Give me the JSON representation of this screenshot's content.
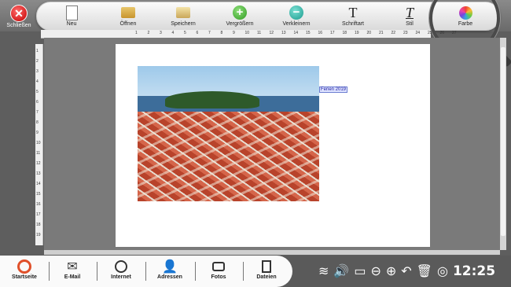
{
  "toolbar": {
    "close_label": "Schließen",
    "tools": [
      {
        "label": "Neu",
        "icon": "new-document-icon"
      },
      {
        "label": "Öffnen",
        "icon": "open-folder-icon"
      },
      {
        "label": "Speichern",
        "icon": "save-icon"
      },
      {
        "label": "Vergrößern",
        "icon": "zoom-in-icon"
      },
      {
        "label": "Verkleinern",
        "icon": "zoom-out-icon"
      },
      {
        "label": "Schriftart",
        "icon": "font-icon"
      },
      {
        "label": "Stil",
        "icon": "style-icon"
      },
      {
        "label": "Farbe",
        "icon": "color-wheel-icon"
      }
    ]
  },
  "ruler": {
    "h_ticks": [
      "1",
      "2",
      "3",
      "4",
      "5",
      "6",
      "7",
      "8",
      "9",
      "10",
      "11",
      "12",
      "13",
      "14",
      "15",
      "16",
      "17",
      "18",
      "19",
      "20",
      "21",
      "22",
      "23",
      "24",
      "25",
      "26",
      "27"
    ],
    "v_ticks": [
      "1",
      "2",
      "3",
      "4",
      "5",
      "6",
      "7",
      "8",
      "9",
      "10",
      "11",
      "12",
      "13",
      "14",
      "15",
      "16",
      "17",
      "18",
      "19"
    ]
  },
  "document": {
    "caption": "Ferien 2019"
  },
  "taskbar": {
    "items": [
      {
        "label": "Startseite",
        "icon": "home-logo-icon"
      },
      {
        "label": "E-Mail",
        "icon": "mail-icon"
      },
      {
        "label": "Internet",
        "icon": "globe-icon"
      },
      {
        "label": "Adressen",
        "icon": "contacts-icon"
      },
      {
        "label": "Fotos",
        "icon": "camera-icon"
      },
      {
        "label": "Dateien",
        "icon": "files-icon"
      }
    ],
    "clock": "12:25"
  }
}
